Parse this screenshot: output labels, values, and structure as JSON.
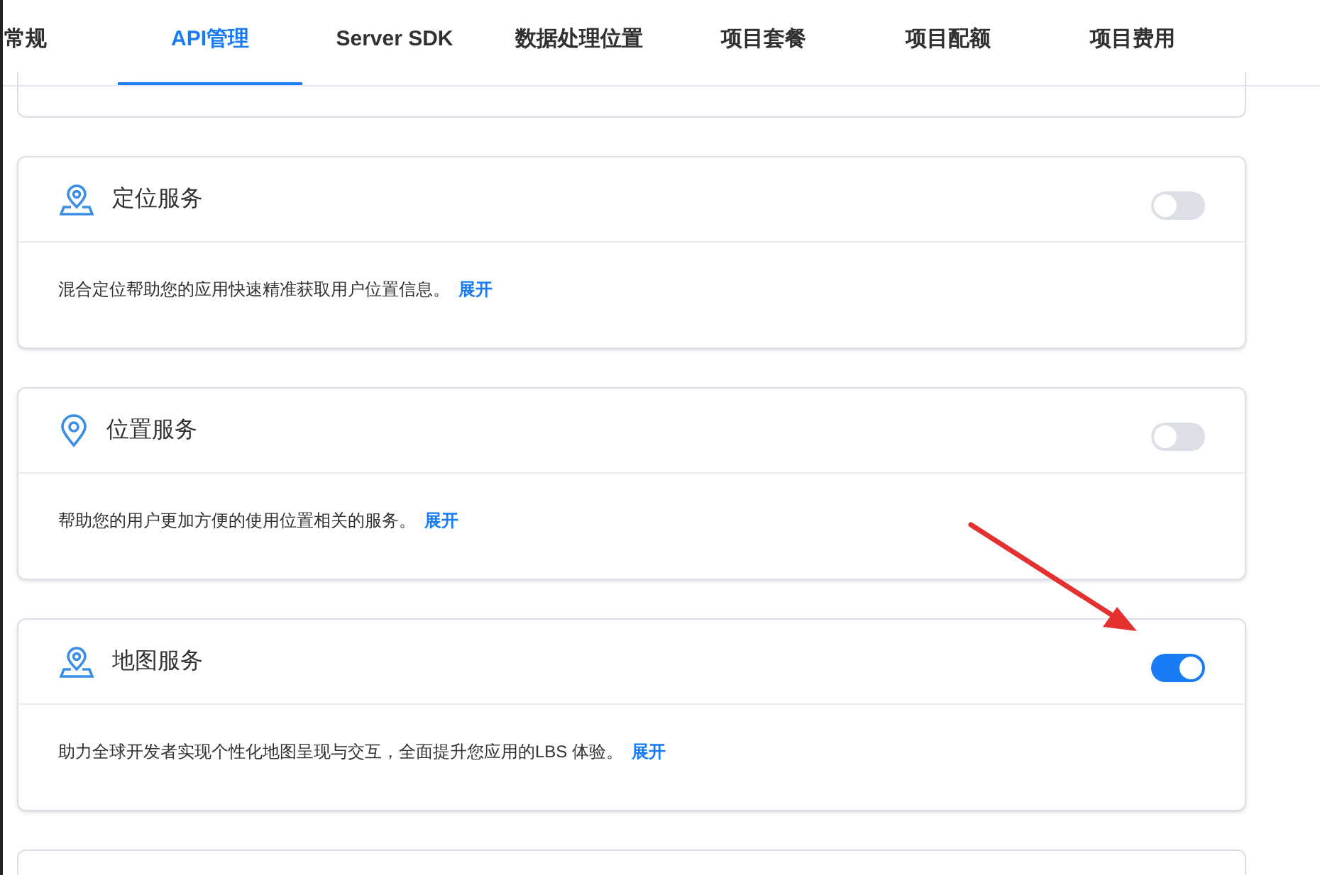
{
  "tabs": [
    {
      "label": "常规",
      "selected": false
    },
    {
      "label": "API管理",
      "selected": true
    },
    {
      "label": "Server SDK",
      "selected": false
    },
    {
      "label": "数据处理位置",
      "selected": false
    },
    {
      "label": "项目套餐",
      "selected": false
    },
    {
      "label": "项目配额",
      "selected": false
    },
    {
      "label": "项目费用",
      "selected": false
    }
  ],
  "services": [
    {
      "title": "定位服务",
      "kind": "area",
      "on": false,
      "description": "混合定位帮助您的应用快速精准获取用户位置信息。",
      "link": "展开"
    },
    {
      "title": "位置服务",
      "kind": "point",
      "on": false,
      "description": "帮助您的用户更加方便的使用位置相关的服务。",
      "link": "展开"
    },
    {
      "title": "地图服务",
      "kind": "area",
      "on": true,
      "description": "助力全球开发者实现个性化地图呈现与交互，全面提升您应用的LBS 体验。",
      "link": "展开"
    }
  ]
}
